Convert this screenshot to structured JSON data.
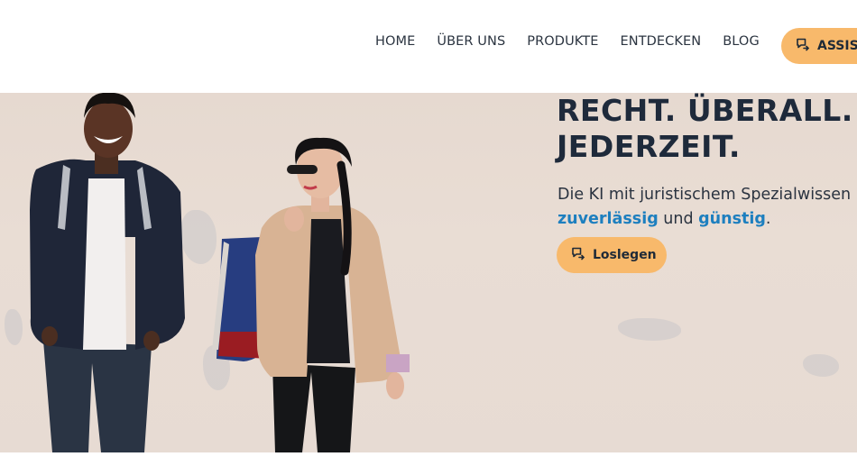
{
  "nav": {
    "items": [
      "HOME",
      "ÜBER UNS",
      "PRODUKTE",
      "ENTDECKEN",
      "BLOG"
    ],
    "assist_label": "ASSIS",
    "assist_icon": "chat-arrow-icon"
  },
  "hero": {
    "title": "RECHT. ÜBERALL.\nJEDERZEIT.",
    "subtitle_prefix": "Die KI mit juristischem Spezialwissen",
    "highlight1": "zuverlässig",
    "connector": " und ",
    "highlight2": "günstig",
    "suffix": ".",
    "cta_label": "Loslegen",
    "cta_icon": "chat-arrow-icon",
    "image_alt": "two people standing in front of a wall"
  },
  "colors": {
    "accent": "#f8b96b",
    "highlight": "#1d7fbf",
    "heading": "#1e2a3b"
  }
}
